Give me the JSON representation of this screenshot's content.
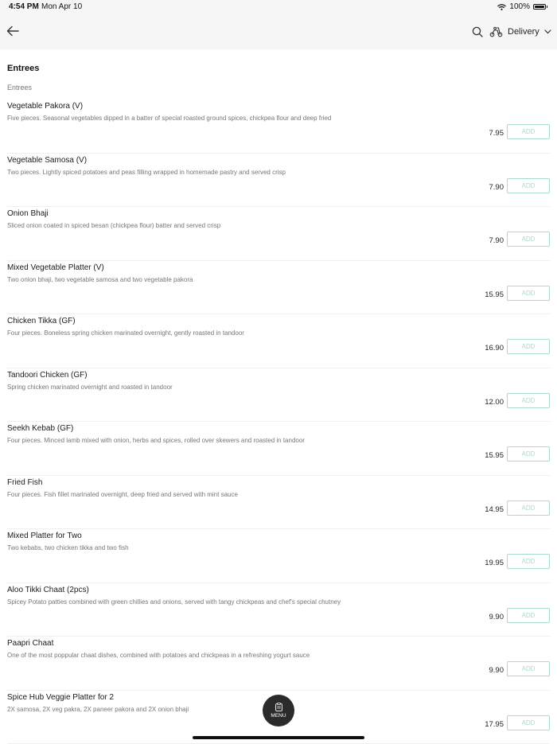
{
  "status": {
    "time": "4:54 PM",
    "date": "Mon Apr 10",
    "battery": "100%"
  },
  "nav": {
    "delivery_label": "Delivery"
  },
  "menu": {
    "section_title": "Entrees",
    "category_label": "Entrees",
    "add_label": "ADD",
    "items": [
      {
        "name": "Vegetable Pakora (V)",
        "description": "Five pieces. Seasonal vegetables dipped in a batter of special roasted ground spices, chickpea flour and deep fried",
        "price": "7.95"
      },
      {
        "name": "Vegetable Samosa (V)",
        "description": "Two pieces. Lightly spiced potatoes and peas filling wrapped in homemade pastry and served crisp",
        "price": "7.90"
      },
      {
        "name": "Onion Bhaji",
        "description": "Sliced onion coated in spiced besan (chickpea flour) batter and served crisp",
        "price": "7.90"
      },
      {
        "name": "Mixed Vegetable Platter (V)",
        "description": "Two onion bhaji, two vegetable samosa and two vegetable pakora",
        "price": "15.95"
      },
      {
        "name": "Chicken Tikka (GF)",
        "description": "Four pieces. Boneless spring chicken marinated overnight, gently roasted in tandoor",
        "price": "16.90"
      },
      {
        "name": "Tandoori Chicken (GF)",
        "description": "Spring chicken marinated overnight and roasted in tandoor",
        "price": "12.00"
      },
      {
        "name": "Seekh Kebab (GF)",
        "description": "Four pieces. Minced lamb mixed with onion, herbs and spices, rolled over skewers and roasted in tandoor",
        "price": "15.95"
      },
      {
        "name": "Fried Fish",
        "description": "Four pieces. Fish fillet marinated overnight, deep fried and served with mint sauce",
        "price": "14.95"
      },
      {
        "name": "Mixed Platter for Two",
        "description": "Two kebabs, two chicken tikka and two fish",
        "price": "19.95"
      },
      {
        "name": "Aloo Tikki Chaat (2pcs)",
        "description": "Spicey Potato patties combined with green chillies and onions, served with tangy chickpeas and chef's special chutney",
        "price": "9.90"
      },
      {
        "name": "Paapri Chaat",
        "description": "One of the most poppular chaat dishes, combined with potatoes and chickpeas in a refreshing yogurt sauce",
        "price": "9.90"
      },
      {
        "name": "Spice Hub Veggie Platter for 2",
        "description": "2X samosa, 2X veg pakra, 2X paneer pakora and 2X onion bhaji",
        "price": "17.95"
      }
    ]
  },
  "fab": {
    "label": "MENU"
  },
  "colors": {
    "accent": "#a9dcc9",
    "header_bg": "#f6f6f6",
    "fab_bg": "#2b2b2b"
  }
}
